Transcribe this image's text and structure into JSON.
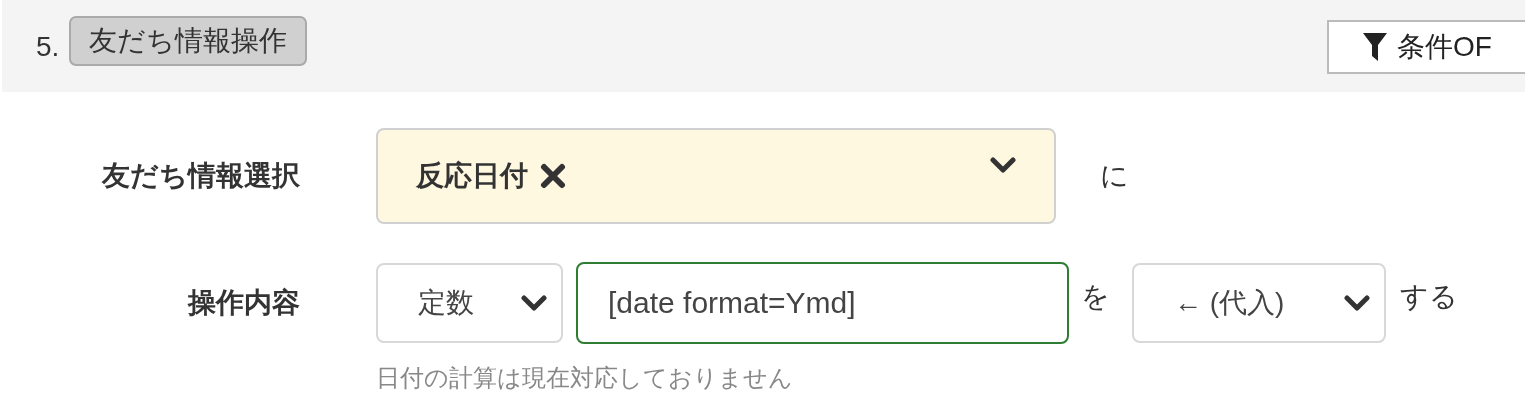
{
  "section": {
    "number": "5.",
    "title": "友だち情報操作",
    "filter_button": "条件OF"
  },
  "rows": [
    {
      "kind": "tag-select",
      "label": "友だち情報選択",
      "tags": [
        "反応日付"
      ],
      "suffix": "に"
    },
    {
      "kind": "operation",
      "label": "操作内容",
      "type_select": "定数",
      "value": "[date format=Ymd]",
      "particle": "を",
      "operator_select": "← (代入)",
      "suffix": "する",
      "help": "日付の計算は現在対応しておりません"
    }
  ]
}
